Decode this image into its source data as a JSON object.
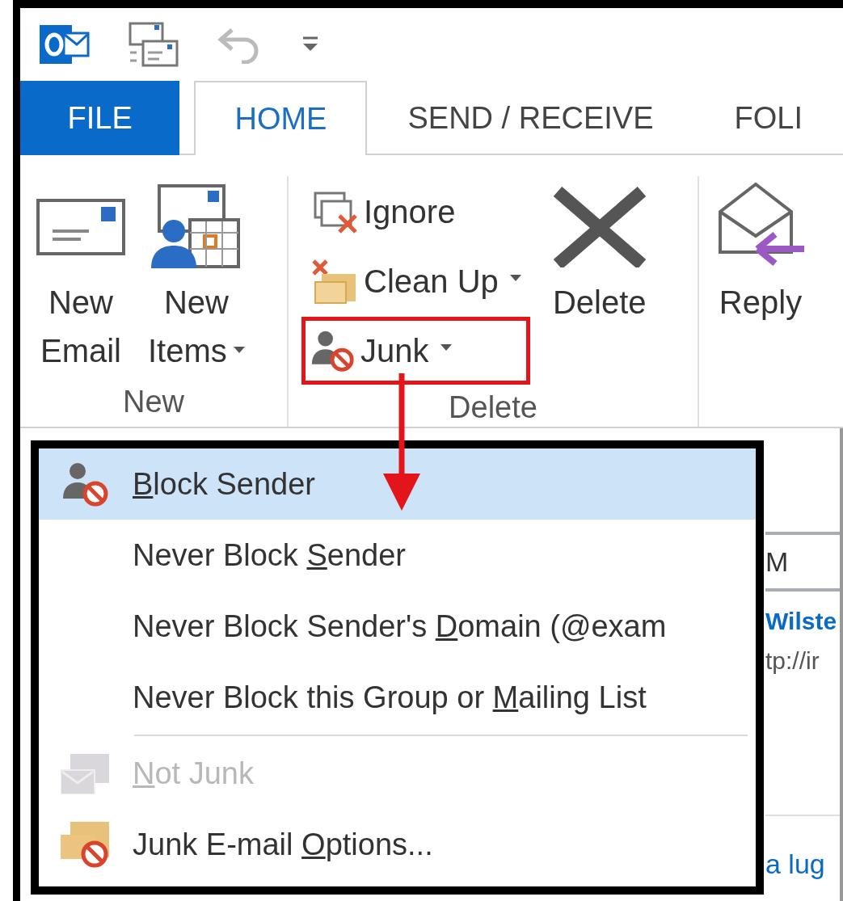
{
  "tabs": [
    {
      "label": "FILE",
      "kind": "file",
      "selected": false
    },
    {
      "label": "HOME",
      "kind": "tab",
      "selected": true
    },
    {
      "label": "SEND / RECEIVE",
      "kind": "tab",
      "selected": false
    },
    {
      "label": "FOLI",
      "kind": "tab",
      "selected": false
    }
  ],
  "ribbon": {
    "groups": [
      {
        "label": "New",
        "buttons": [
          {
            "kind": "new-email",
            "lines": [
              "New",
              "Email"
            ]
          },
          {
            "kind": "new-items",
            "lines": [
              "New",
              "Items"
            ],
            "dropdown": true
          }
        ]
      },
      {
        "label": "Delete",
        "small_buttons": [
          {
            "kind": "ignore",
            "label": "Ignore",
            "dropdown": false,
            "highlighted": false
          },
          {
            "kind": "cleanup",
            "label": "Clean Up",
            "dropdown": true,
            "highlighted": false
          },
          {
            "kind": "junk",
            "label": "Junk",
            "dropdown": true,
            "highlighted": true
          }
        ],
        "buttons": [
          {
            "kind": "delete",
            "lines": [
              "Delete"
            ]
          }
        ]
      },
      {
        "buttons": [
          {
            "kind": "reply",
            "lines": [
              "Reply"
            ]
          }
        ]
      }
    ]
  },
  "junk_menu": {
    "items": [
      {
        "kind": "block",
        "key": "B",
        "after": "lock Sender",
        "selected": true,
        "disabled": false
      },
      {
        "kind": "plain",
        "before": "Never Block ",
        "key": "S",
        "after": "ender",
        "selected": false,
        "disabled": false
      },
      {
        "kind": "plain",
        "before": "Never Block Sender's ",
        "key": "D",
        "after": "omain (@exam",
        "selected": false,
        "disabled": false
      },
      {
        "kind": "plain",
        "before": "Never Block this Group or ",
        "key": "M",
        "after": "ailing List",
        "selected": false,
        "disabled": false
      },
      {
        "kind": "separator"
      },
      {
        "kind": "notjunk",
        "key": "N",
        "after": "ot Junk",
        "selected": false,
        "disabled": true
      },
      {
        "kind": "options",
        "before": "Junk E-mail ",
        "key": "O",
        "after": "ptions...",
        "selected": false,
        "disabled": false
      }
    ]
  },
  "message_list": {
    "column_1": [
      "M",
      "Wilste",
      "tp://ir",
      "a lug"
    ]
  }
}
